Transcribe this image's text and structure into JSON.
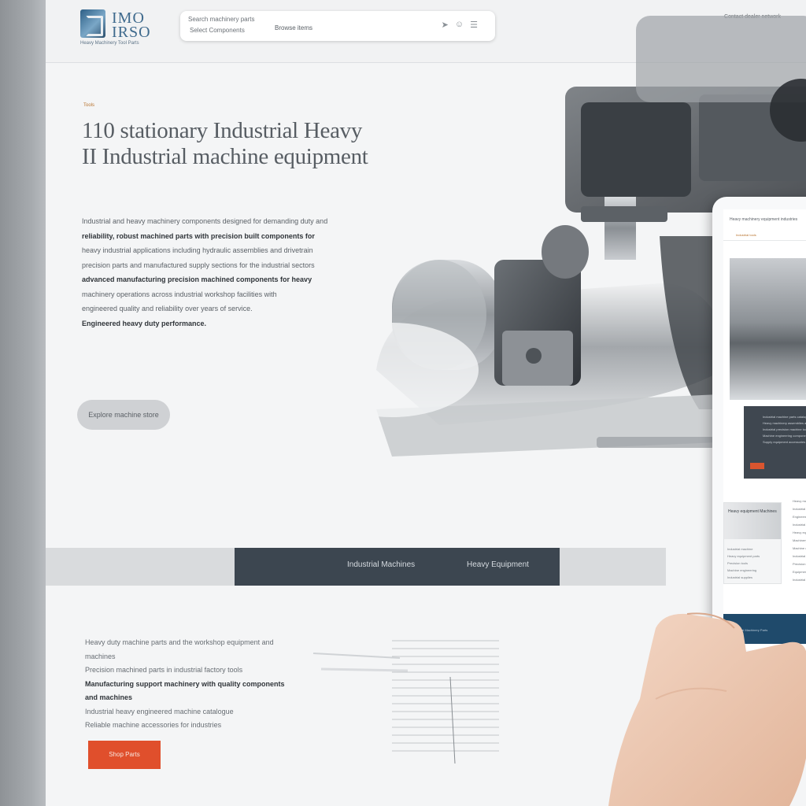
{
  "header": {
    "logo_word": "IMO\nIRSO",
    "logo_sub": "Heavy Machinery Tool Parts",
    "search_line1": "Search machinery parts",
    "search_line2": "Select Components",
    "search_button": "Browse items",
    "top_right": "Contact dealer network"
  },
  "hero": {
    "eyebrow": "Tools",
    "title_line1": "110 stationary Industrial Heavy",
    "title_line2": "II Industrial machine equipment",
    "body": [
      "Industrial and heavy machinery components designed for demanding duty and",
      "reliability, robust machined parts with precision built components for",
      "heavy industrial applications including hydraulic assemblies and drivetrain",
      "precision parts and manufactured supply sections for the industrial sectors",
      "advanced manufacturing precision machined components for heavy",
      "machinery operations across industrial workshop facilities with",
      "engineered quality and reliability over years of service.",
      "Engineered heavy duty performance."
    ],
    "cta": "Explore machine store"
  },
  "tabs": {
    "tab1": "Industrial Machines",
    "tab2": "Heavy Equipment"
  },
  "lower": {
    "lines": [
      "Heavy duty machine parts and the workshop equipment and machines",
      "Precision machined parts in industrial factory tools",
      "Manufacturing support machinery with quality components and machines",
      "Industrial heavy engineered machine catalogue",
      "Reliable machine accessories for industries"
    ],
    "button": "Shop Parts"
  },
  "tablet": {
    "head": "Heavy machinery equipment industries",
    "head_sub": "Industrial tools",
    "dark_lines": [
      "Industrial machine parts catalogue",
      "Heavy machinery assemblies and parts",
      "Industrial precision machine tools",
      "Machine engineering components",
      "Supply equipment accessories"
    ],
    "card_head": "Heavy equipment Machines",
    "card_lines": [
      "Industrial machine",
      "Heavy equipment parts",
      "Precision tools",
      "Machine engineering",
      "Industrial supplies"
    ],
    "right_lines": [
      "Heavy machine parts catalog",
      "Industrial precision machines",
      "Engineered machine components",
      "Industrial tool parts",
      "Heavy equipment supply",
      "Machinery workshop",
      "Machine catalog parts",
      "Industrial heavy parts",
      "Precision machine tools",
      "Equipment engineering parts",
      "Industrial machinery"
    ],
    "footer": "Industrial Machinery Parts"
  }
}
